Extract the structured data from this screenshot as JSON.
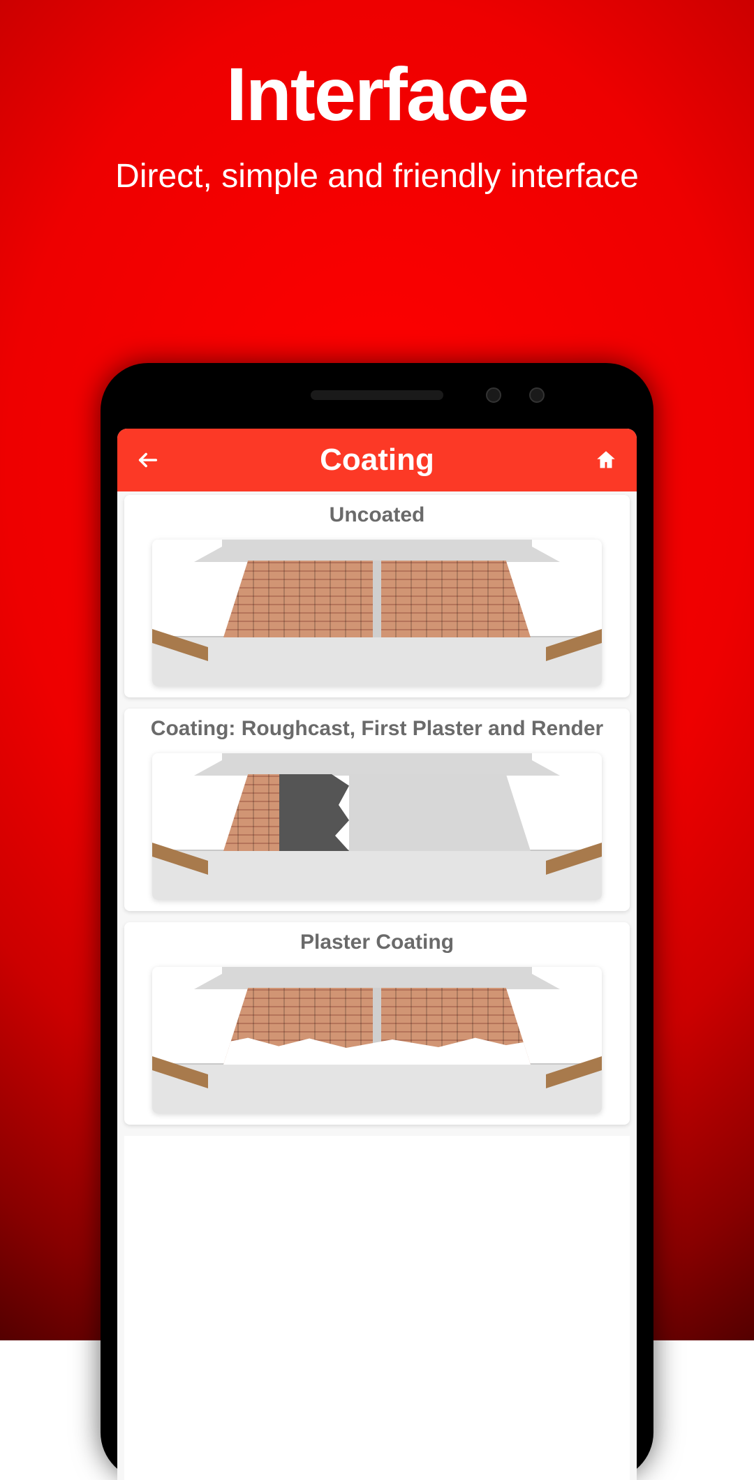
{
  "page": {
    "title": "Interface",
    "subtitle": "Direct, simple and friendly interface"
  },
  "app": {
    "bar": {
      "title": "Coating",
      "back_icon": "arrow-left",
      "home_icon": "home"
    },
    "cards": [
      {
        "title": "Uncoated"
      },
      {
        "title": "Coating: Roughcast, First Plaster and Render"
      },
      {
        "title": "Plaster Coating"
      }
    ]
  }
}
